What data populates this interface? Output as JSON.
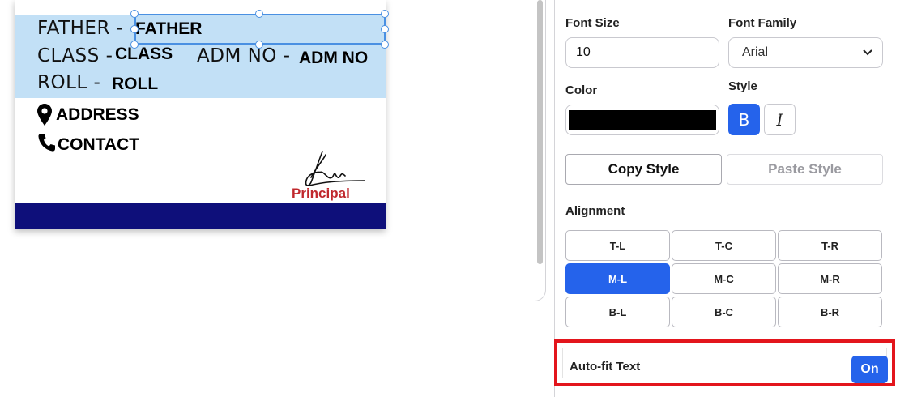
{
  "card": {
    "father_label": "FATHER -",
    "father_value": "FATHER",
    "class_label": "CLASS -",
    "class_value": "CLASS",
    "adm_label": "ADM NO -",
    "adm_value": "ADM NO",
    "roll_label": "ROLL  -",
    "roll_value": "ROLL",
    "address_value": "ADDRESS",
    "contact_value": "CONTACT",
    "principal_label": "Principal",
    "band_color": "#c2e0f6",
    "footer_color": "#0e0f7a"
  },
  "panel": {
    "font_size_label": "Font Size",
    "font_size_value": "10",
    "font_family_label": "Font Family",
    "font_family_value": "Arial",
    "color_label": "Color",
    "color_value": "#000000",
    "style_label": "Style",
    "bold_glyph": "B",
    "italic_glyph": "I",
    "bold_active": true,
    "copy_style_label": "Copy Style",
    "paste_style_label": "Paste Style",
    "alignment_label": "Alignment",
    "alignment_options": [
      "T-L",
      "T-C",
      "T-R",
      "M-L",
      "M-C",
      "M-R",
      "B-L",
      "B-C",
      "B-R"
    ],
    "alignment_selected": "M-L",
    "autofit_label": "Auto-fit Text",
    "autofit_state": "On",
    "accent_color": "#2563eb",
    "highlight_color": "#e3151c"
  },
  "icons": [
    "location-pin-icon",
    "phone-icon",
    "chevron-down-icon",
    "signature-icon"
  ]
}
